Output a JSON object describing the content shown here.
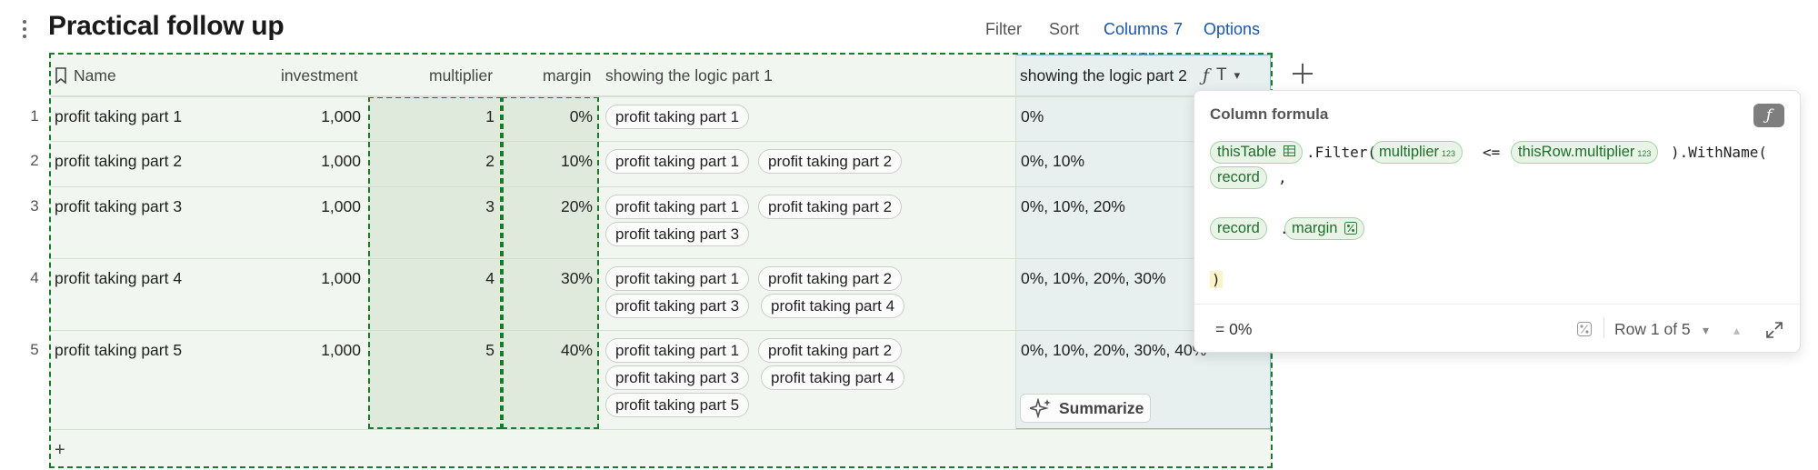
{
  "page": {
    "title": "Practical follow up"
  },
  "toolbar": {
    "filter": "Filter",
    "sort": "Sort",
    "columns": "Columns",
    "columns_count": "7",
    "options": "Options"
  },
  "table": {
    "headers": {
      "name": "Name",
      "investment": "investment",
      "multiplier": "multiplier",
      "margin": "margin",
      "logic1": "showing the logic part 1",
      "logic2": "showing the logic part 2"
    },
    "rows": [
      {
        "num": "1",
        "name": "profit taking part 1",
        "investment": "1,000",
        "multiplier": "1",
        "margin": "0%",
        "logic1": [
          "profit taking part 1"
        ],
        "logic2": "0%"
      },
      {
        "num": "2",
        "name": "profit taking part 2",
        "investment": "1,000",
        "multiplier": "2",
        "margin": "10%",
        "logic1": [
          "profit taking part 1",
          "profit taking part 2"
        ],
        "logic2": "0%, 10%"
      },
      {
        "num": "3",
        "name": "profit taking part 3",
        "investment": "1,000",
        "multiplier": "3",
        "margin": "20%",
        "logic1": [
          "profit taking part 1",
          "profit taking part 2",
          "profit taking part 3"
        ],
        "logic2": "0%, 10%, 20%"
      },
      {
        "num": "4",
        "name": "profit taking part 4",
        "investment": "1,000",
        "multiplier": "4",
        "margin": "30%",
        "logic1": [
          "profit taking part 1",
          "profit taking part 2",
          "profit taking part 3",
          "profit taking part 4"
        ],
        "logic2": "0%, 10%, 20%, 30%"
      },
      {
        "num": "5",
        "name": "profit taking part 5",
        "investment": "1,000",
        "multiplier": "5",
        "margin": "40%",
        "logic1": [
          "profit taking part 1",
          "profit taking part 2",
          "profit taking part 3",
          "profit taking part 4",
          "profit taking part 5"
        ],
        "logic2": "0%, 10%, 20%, 30%, 40%"
      }
    ],
    "add_row": "+",
    "summarize": "Summarize"
  },
  "formula_panel": {
    "title": "Column formula",
    "f_symbol": "ƒ",
    "tokens": {
      "this_table": "thisTable",
      "filter_open": ".Filter(",
      "multiplier": "multiplier",
      "type_num": "123",
      "lte": "<=",
      "this_row_multiplier": "thisRow.multiplier",
      "with_name": ").WithName(",
      "record": "record",
      "comma": ",",
      "dot": ".",
      "margin": "margin",
      "close": ")"
    },
    "result": "= 0%",
    "row_info": "Row 1 of 5"
  },
  "colors": {
    "accent_link": "#1a56a8",
    "selection_green": "#197a2a",
    "table_bg": "#f1f7f0",
    "token_bg": "#e8f4e6"
  },
  "icons": [
    "more-vertical-icon",
    "bookmark-icon",
    "formula-icon",
    "text-type-icon",
    "chevron-down-icon",
    "plus-icon",
    "sparkle-icon",
    "percent-type-icon",
    "expand-icon",
    "chevron-up-icon",
    "table-icon"
  ]
}
